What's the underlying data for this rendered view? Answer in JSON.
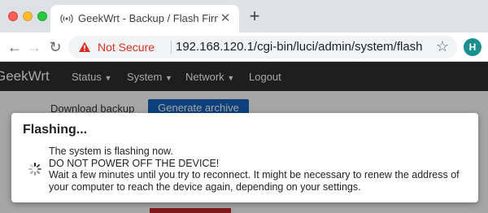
{
  "browser": {
    "tab_title": "GeekWrt - Backup / Flash Firmware",
    "tab_close": "✕",
    "new_tab": "+",
    "security_label": "Not Secure",
    "url": "192.168.120.1/cgi-bin/luci/admin/system/flash",
    "profile_initial": "H"
  },
  "router_nav": {
    "brand": "GeekWrt",
    "items": [
      "Status",
      "System",
      "Network",
      "Logout"
    ]
  },
  "background": {
    "download_backup": "Download backup",
    "generate_archive": "Generate archive"
  },
  "modal": {
    "title": "Flashing...",
    "lines": [
      "The system is flashing now.",
      "DO NOT POWER OFF THE DEVICE!",
      "Wait a few minutes until you try to reconnect. It might be necessary to renew the address of",
      "your computer to reach the device again, depending on your settings."
    ]
  },
  "colors": {
    "warning": "#d93025",
    "primary_button": "#1565c0",
    "navbar": "#2e2e2e"
  },
  "icons": {
    "favicon": "broadcast-icon",
    "warning": "warning-triangle-icon",
    "bookmark": "star-icon",
    "spinner": "spinner-icon"
  }
}
